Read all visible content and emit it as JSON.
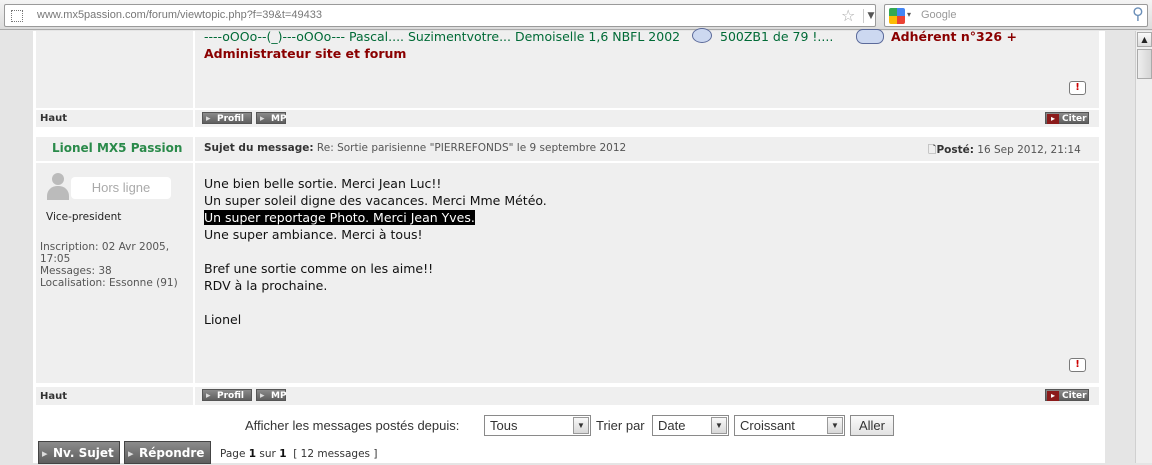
{
  "browser": {
    "url": "www.mx5passion.com/forum/viewtopic.php?f=39&t=49433",
    "search_placeholder": "Google"
  },
  "prev_post": {
    "signature_line1": "----oOOo--(_)---oOOo--- Pascal.... Suzimentvotre... Demoiselle 1,6 NBFL 2002",
    "signature_mid": "500ZB1 de 79 !....",
    "signature_line2": "Administrateur site et forum",
    "adherent": "Adhérent n°326 +",
    "haut": "Haut",
    "profil": "Profil",
    "mp": "MP",
    "citer": "Citer"
  },
  "post": {
    "author": "Lionel MX5 Passion",
    "subject_label": "Sujet du message:",
    "subject": "Re: Sortie parisienne \"PIERREFONDS\" le 9 septembre 2012",
    "posted_label": "Posté:",
    "posted_date": "16 Sep 2012, 21:14",
    "status": "Hors ligne",
    "rank": "Vice-president",
    "inscription": "Inscription: 02 Avr 2005, 17:05",
    "messages": "Messages: 38",
    "localisation": "Localisation: Essonne (91)",
    "lines": [
      "Une bien belle sortie. Merci Jean Luc!!",
      "Un super soleil digne des vacances. Merci Mme Météo.",
      "Un super reportage Photo. Merci Jean Yves.",
      "Une super ambiance. Merci à tous!",
      "",
      "Bref une sortie comme on les aime!!",
      "RDV à la prochaine.",
      "",
      "Lionel"
    ],
    "haut": "Haut",
    "profil": "Profil",
    "mp": "MP",
    "citer": "Citer"
  },
  "filter": {
    "label": "Afficher les messages postés depuis:",
    "since": "Tous",
    "sort_label": "Trier par",
    "sort_by": "Date",
    "order": "Croissant",
    "go": "Aller"
  },
  "actions": {
    "new_topic": "Nv. Sujet",
    "reply": "Répondre"
  },
  "pagination": {
    "page_word": "Page",
    "current": "1",
    "of_word": "sur",
    "total": "1",
    "messages": "[ 12 messages ]"
  },
  "icons": [
    "star-icon",
    "search-icon",
    "report-icon",
    "smiley-icon",
    "post-icon"
  ]
}
